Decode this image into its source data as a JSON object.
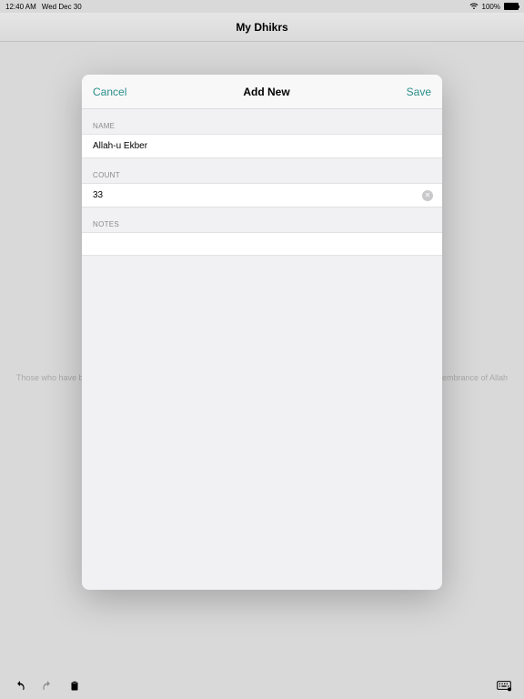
{
  "status": {
    "time": "12:40 AM",
    "date": "Wed Dec 30",
    "battery": "100%"
  },
  "nav": {
    "title": "My Dhikrs"
  },
  "background": {
    "text_left": "Those who have b",
    "text_right": "embrance of Allah"
  },
  "modal": {
    "cancel": "Cancel",
    "title": "Add New",
    "save": "Save",
    "sections": {
      "name_label": "NAME",
      "name_value": "Allah-u Ekber",
      "count_label": "COUNT",
      "count_value": "33",
      "notes_label": "NOTES",
      "notes_value": ""
    }
  }
}
